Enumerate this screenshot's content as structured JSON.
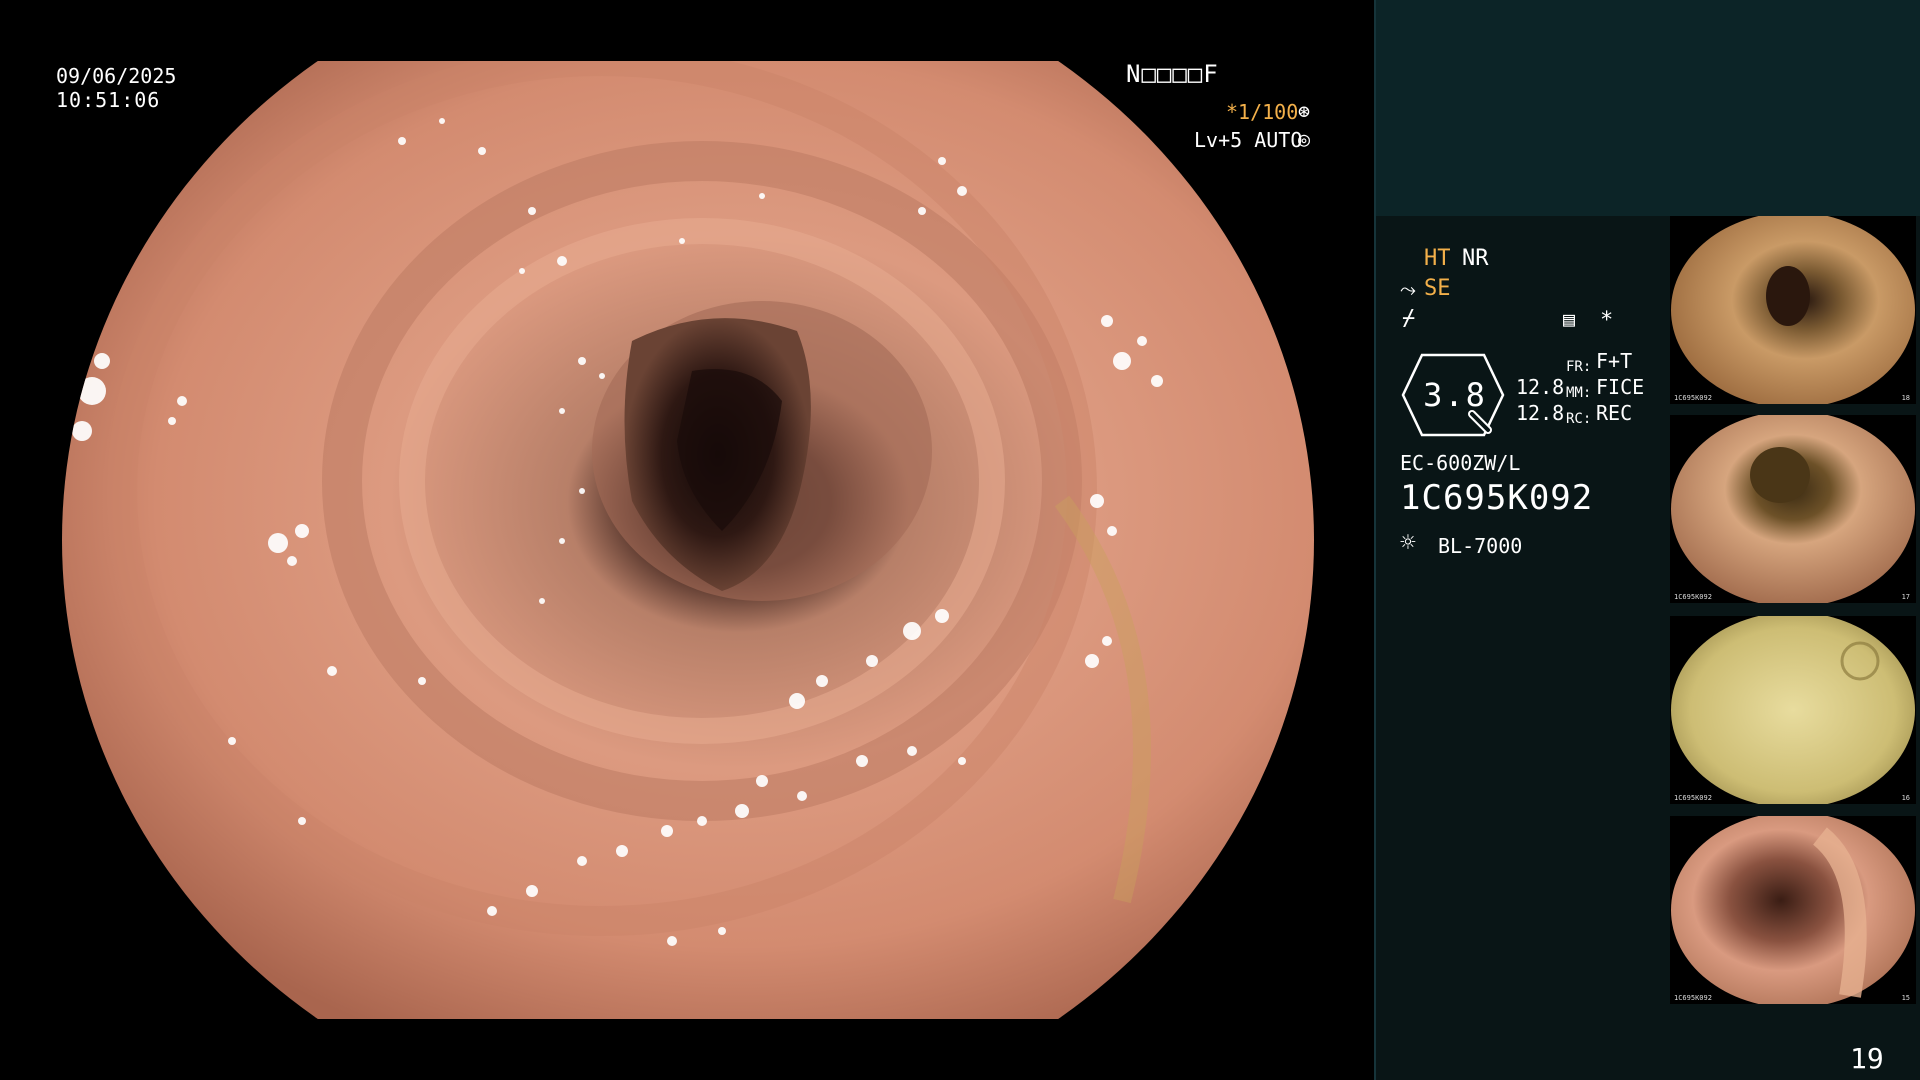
{
  "osd": {
    "date": "09/06/2025",
    "time": "10:51:06",
    "mode": "N□□□□F",
    "shutter": "*1/100",
    "shutter_icon": "aperture-icon",
    "level": "Lv+5 AUTO",
    "level_icon": "iris-icon"
  },
  "panel": {
    "ht": "HT",
    "nr": "NR",
    "se": "SE",
    "se_icon_glyph": "⤳",
    "enhance_icon_glyph": "⌿",
    "grid_icon_glyph": "▤",
    "star_icon_glyph": "*",
    "gauge_value": "3.8",
    "value_1": "12.8",
    "value_2": "12.8",
    "fr_label": "FR:",
    "fr_value": "F+T",
    "mm_label": "MM:",
    "mm_value": "FICE",
    "rc_label": "RC:",
    "rc_value": "REC",
    "scope_model": "EC-600ZW/L",
    "scope_serial": "1C695K092",
    "light_icon_glyph": "☼",
    "light_source": "BL-7000",
    "page_number": "19"
  },
  "thumbnails": [
    {
      "label": "1C695K092",
      "num": "18"
    },
    {
      "label": "1C695K092",
      "num": "17"
    },
    {
      "label": "1C695K092",
      "num": "16"
    },
    {
      "label": "1C695K092",
      "num": "15"
    }
  ],
  "colors": {
    "accent": "#f3b04a",
    "panel_top": "#0c2427",
    "panel_bottom": "#091516",
    "mucosa": "#d99478"
  }
}
